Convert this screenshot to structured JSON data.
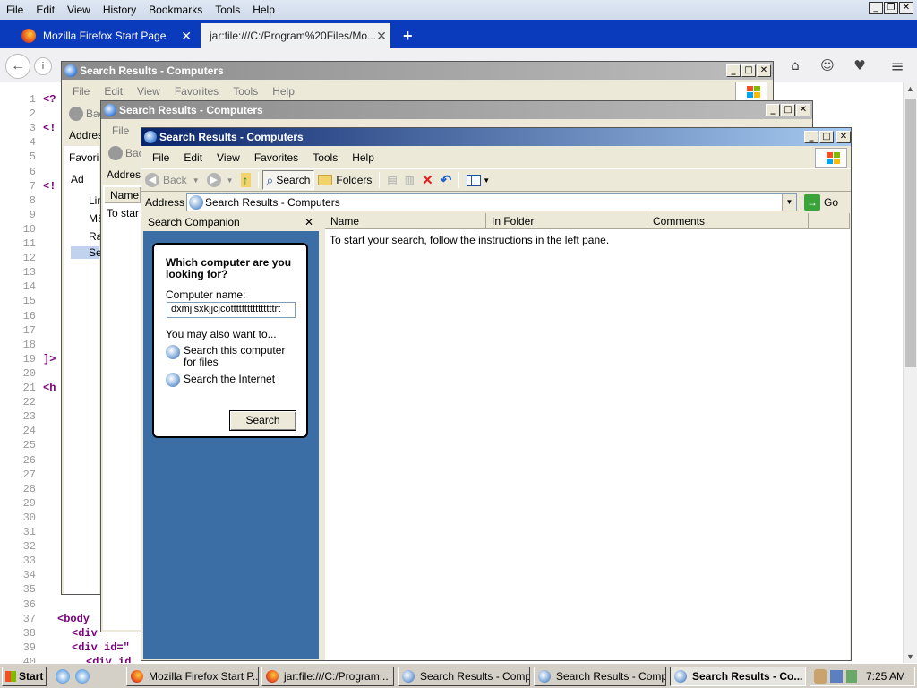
{
  "firefox": {
    "menu": [
      "File",
      "Edit",
      "View",
      "History",
      "Bookmarks",
      "Tools",
      "Help"
    ],
    "tabs": [
      {
        "label": "Mozilla Firefox Start Page"
      },
      {
        "label": "jar:file:///C:/Program%20Files/Mo..."
      }
    ],
    "new_tab": "+",
    "source": {
      "line_numbers": [
        "1",
        "2",
        "3",
        "4",
        "5",
        "6",
        "7",
        "8",
        "9",
        "10",
        "11",
        "12",
        "13",
        "14",
        "15",
        "16",
        "17",
        "18",
        "19",
        "20",
        "21",
        "22",
        "23",
        "24",
        "25",
        "26",
        "27",
        "28",
        "29",
        "30",
        "31",
        "32",
        "33",
        "34",
        "35",
        "36",
        "37",
        "38",
        "39",
        "40"
      ],
      "code_left": [
        {
          "line": "1",
          "text": "<?"
        },
        {
          "line": "3",
          "text": "<!"
        },
        {
          "line": "7",
          "text": "<!"
        },
        {
          "line": "19",
          "text": "]>"
        },
        {
          "line": "21",
          "text": "<h"
        }
      ],
      "code_bottom": [
        {
          "line": "37",
          "text": "<body"
        },
        {
          "line": "38",
          "text": "<div"
        },
        {
          "line": "39",
          "text": "<div id=\""
        },
        {
          "line": "40",
          "text": "<div id"
        }
      ]
    }
  },
  "win_back": {
    "title": "Search Results - Computers",
    "menu": [
      "File",
      "Edit",
      "View",
      "Favorites",
      "Tools",
      "Help"
    ],
    "back": "Bac",
    "address": "Addres",
    "favorites": "Favori",
    "fav_items": [
      "Ad",
      "Lir",
      "MS",
      "Ra",
      "Se"
    ]
  },
  "win_mid": {
    "title": "Search Results - Computers",
    "menu": [
      "File"
    ],
    "back": "Bac",
    "address": "Addres",
    "col_name": "Name",
    "start_text": "To star"
  },
  "win_front": {
    "title": "Search Results - Computers",
    "menu": [
      "File",
      "Edit",
      "View",
      "Favorites",
      "Tools",
      "Help"
    ],
    "toolbar": {
      "back": "Back",
      "search": "Search",
      "folders": "Folders"
    },
    "address_label": "Address",
    "address_value": "Search Results - Computers",
    "go": "Go",
    "columns": [
      "Name",
      "In Folder",
      "Comments"
    ],
    "results_message": "To start your search, follow the instructions in the left pane.",
    "companion": {
      "header": "Search Companion",
      "heading": "Which computer are you looking for?",
      "name_label": "Computer name:",
      "name_value": "dxmjisxkjjcjcottttttttttttttttrt",
      "also": "You may also want to...",
      "link1": "Search this computer for files",
      "link2": "Search the Internet",
      "search_button": "Search"
    }
  },
  "taskbar": {
    "start": "Start",
    "tasks": [
      "Mozilla Firefox Start P...",
      "jar:file:///C:/Program...",
      "Search Results - Comp...",
      "Search Results - Comp...",
      "Search Results - Co..."
    ],
    "clock": "7:25 AM"
  }
}
